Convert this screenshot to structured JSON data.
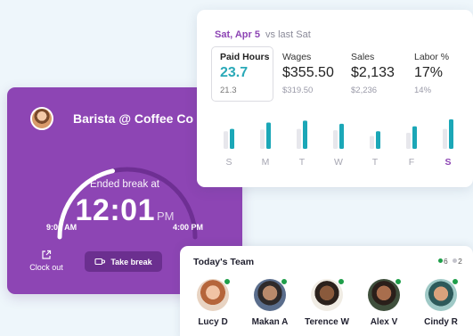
{
  "shift": {
    "title": "Barista @ Coffee Co",
    "status": "Ended break at",
    "time": "12:01",
    "ampm": "PM",
    "start": "9:00 AM",
    "end": "4:00 PM",
    "clock_out_label": "Clock out",
    "take_break_label": "Take break",
    "shift_progress_fraction": 0.43
  },
  "stats": {
    "date": "Sat, Apr 5",
    "compare": "vs last Sat",
    "metrics": [
      {
        "label": "Paid Hours",
        "value": "23.7",
        "previous": "21.3"
      },
      {
        "label": "Wages",
        "value": "$355.50",
        "previous": "$319.50"
      },
      {
        "label": "Sales",
        "value": "$2,133",
        "previous": "$2,236"
      },
      {
        "label": "Labor %",
        "value": "17%",
        "previous": "14%"
      }
    ],
    "days": [
      "S",
      "M",
      "T",
      "W",
      "T",
      "F",
      "S"
    ],
    "active_day_index": 6,
    "bars_current": [
      0.62,
      0.82,
      0.88,
      0.78,
      0.55,
      0.7,
      0.92
    ],
    "bars_previous": [
      0.55,
      0.6,
      0.62,
      0.58,
      0.4,
      0.5,
      0.62
    ],
    "colors": {
      "current": "#1ba7b7",
      "previous": "#e7e7ec",
      "accent": "#8d45b4"
    }
  },
  "team": {
    "title": "Today's Team",
    "online_count": "6",
    "offline_count": "2",
    "members": [
      {
        "name": "Lucy D"
      },
      {
        "name": "Makan A"
      },
      {
        "name": "Terence W"
      },
      {
        "name": "Alex V"
      },
      {
        "name": "Cindy R"
      }
    ]
  }
}
